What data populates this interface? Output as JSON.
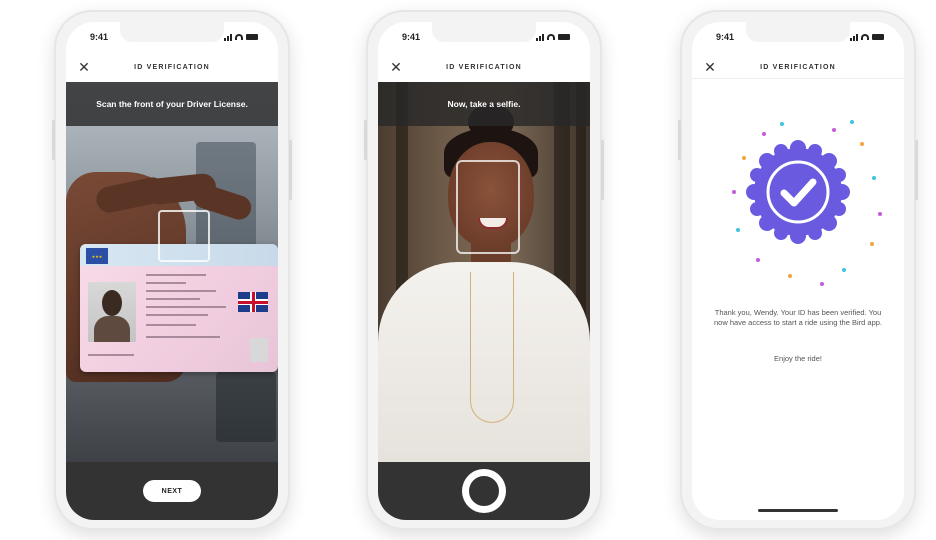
{
  "status_time": "9:41",
  "nav_title": "ID VERIFICATION",
  "screens": [
    {
      "instruction": "Scan the front of your Driver License.",
      "button_label": "NEXT"
    },
    {
      "instruction": "Now, take a selfie."
    },
    {
      "message": "Thank you, Wendy. Your ID has been verified. You now have access to start a ride using the Bird app.",
      "enjoy": "Enjoy the ride!"
    }
  ],
  "colors": {
    "badge": "#6a5ae0",
    "bar_dark": "#333333"
  },
  "icons": [
    "close-icon",
    "signal-icon",
    "wifi-icon",
    "battery-icon",
    "eu-flag-icon",
    "uk-flag-icon",
    "checkmark-badge-icon",
    "shutter-icon"
  ]
}
